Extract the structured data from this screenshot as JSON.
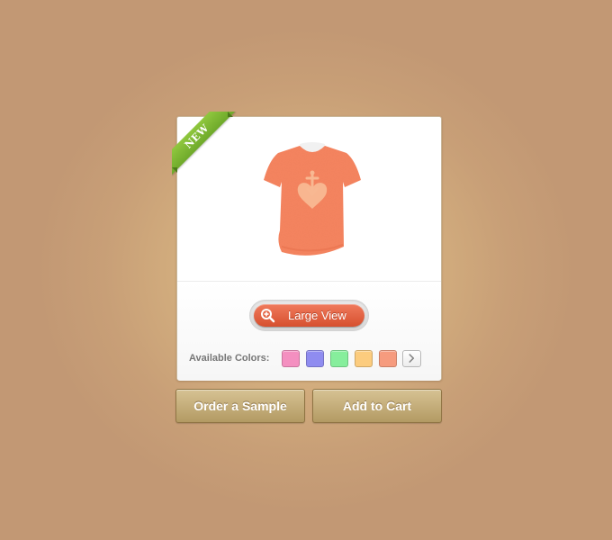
{
  "product": {
    "badge": "NEW",
    "image": "orange-tshirt-with-heart-print",
    "shirt_color": "#f5845f",
    "print_color": "#f8b892"
  },
  "large_view": {
    "label": "Large View",
    "icon": "zoom-in-icon",
    "accent": "#e2603e"
  },
  "colors": {
    "label": "Available Colors:",
    "swatches": [
      {
        "name": "pink",
        "hex": "#f48fc0"
      },
      {
        "name": "purple",
        "hex": "#8f8cf0"
      },
      {
        "name": "green",
        "hex": "#86ee9c"
      },
      {
        "name": "yellow",
        "hex": "#fccc7e"
      },
      {
        "name": "orange",
        "hex": "#f69b7e"
      }
    ],
    "next_icon": "chevron-right-icon"
  },
  "actions": {
    "order_sample": "Order a Sample",
    "add_to_cart": "Add to Cart"
  }
}
